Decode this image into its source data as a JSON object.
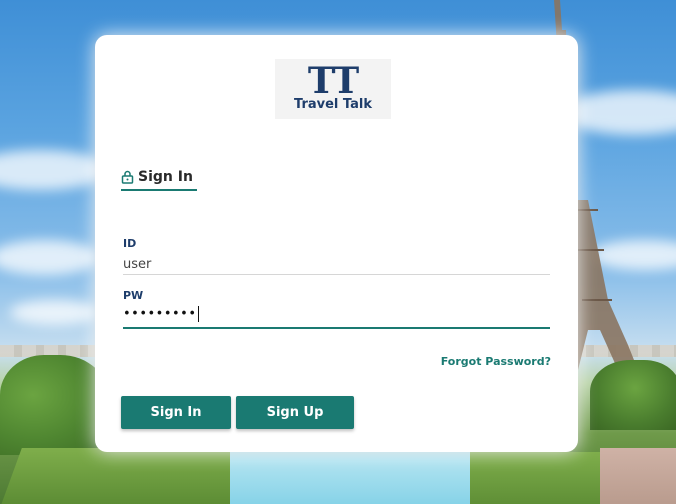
{
  "logo": {
    "letters": "TT",
    "name": "Travel Talk"
  },
  "tab": {
    "icon": "lock-icon",
    "label": "Sign In"
  },
  "form": {
    "id_label": "ID",
    "id_value": "user",
    "pw_label": "PW",
    "pw_masked": "•••••••••"
  },
  "links": {
    "forgot": "Forgot Password?"
  },
  "buttons": {
    "sign_in": "Sign In",
    "sign_up": "Sign Up"
  },
  "colors": {
    "accent": "#1a7a72",
    "logo": "#1e3d6b",
    "card": "#ffffff"
  }
}
